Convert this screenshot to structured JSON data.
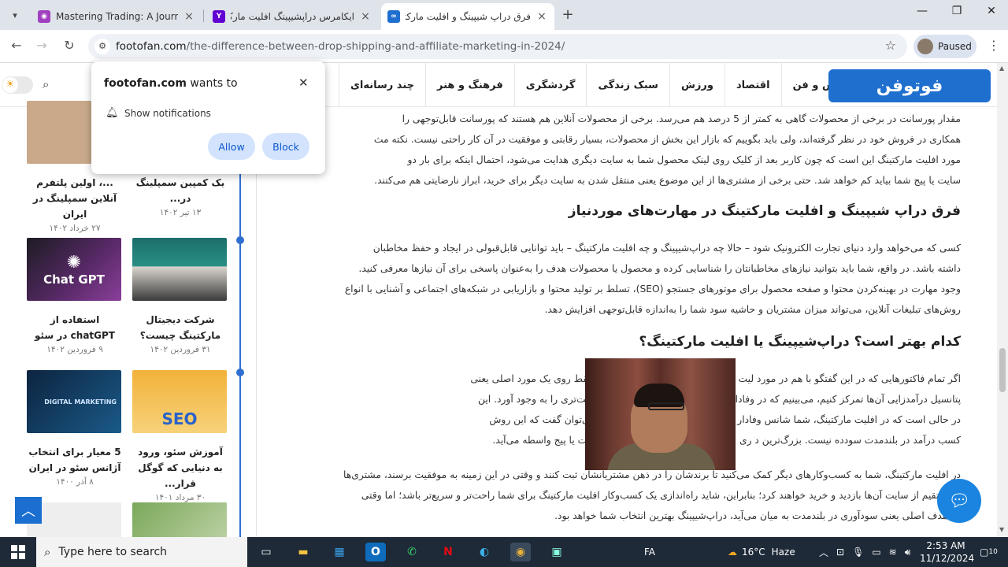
{
  "browser": {
    "tabs": [
      {
        "title": "Mastering Trading: A Journey fr",
        "favicon": "podcast-icon",
        "color": "#a03fbf"
      },
      {
        "title": "ایکامرس دراپشیپینگ افلیت مارکتی",
        "favicon": "yahoo-icon",
        "color": "#6001d2"
      },
      {
        "title": "فرق دراپ شیپینگ و افلیت مارکتی",
        "favicon": "footofan-icon",
        "color": "#1f6fcf"
      }
    ],
    "active_tab": 2,
    "url_host": "footofan.com",
    "url_path": "/the-difference-between-drop-shipping-and-affiliate-marketing-in-2024/",
    "profile_label": "Paused"
  },
  "popup": {
    "site": "footofan.com",
    "title_suffix": "wants to",
    "permission": "Show notifications",
    "allow_label": "Allow",
    "block_label": "Block"
  },
  "site": {
    "logo_text": "فوتوفن",
    "menu": [
      "دانش و فن",
      "اقتصاد",
      "ورزش",
      "سبک زندگی",
      "گردشگری",
      "فرهنگ و هنر",
      "چند رسانه‌ای"
    ]
  },
  "sidebar": {
    "cards": [
      {
        "title": "...، اولین پلتفرم آنلاین سمپلینگ در ایران",
        "date": "۲۷ خرداد ۱۴۰۲"
      },
      {
        "title": "یک کمپین سمپلینگ در...",
        "date": "۱۳ تیر ۱۴۰۲"
      },
      {
        "title": "استفاده از chatGPT در سئو",
        "date": "۹ فروردین ۱۴۰۲",
        "thumb_text": "Chat GPT"
      },
      {
        "title": "شرکت دیجیتال مارکتینگ چیست؟",
        "date": "۳۱ فروردین ۱۴۰۲"
      },
      {
        "title": "5 معیار برای انتخاب آژانس سئو در ایران",
        "date": "۸ آذر ۱۴۰۰",
        "thumb_text": "DIGITAL MARKETING"
      },
      {
        "title": "آموزش سئو، ورود به دنیایی که گوگل قرار...",
        "date": "۳۰ مرداد ۱۴۰۱",
        "thumb_text": "SEO"
      }
    ]
  },
  "article": {
    "para1": [
      "مقدار پورسانت در برخی از محصولات گاهی به کمتر از 5 درصد هم می‌رسد. برخی از محصولات آنلاین هم هستند که پورسانت قابل‌توجهی را",
      "همکاری در فروش خود در نظر گرفته‌اند، ولی باید بگوییم که بازار این بخش از محصولات، بسیار رقابتی و موفقیت در آن کار راحتی نیست. نکته مث",
      "مورد افلیت مارکتینگ این است که چون کاربر بعد از کلیک روی لینک محصول شما به سایت دیگری هدایت می‌شود، احتمال اینکه برای بار دو",
      "سایت یا پیج شما بیاید کم خواهد شد. حتی برخی از مشتری‌ها از این موضوع یعنی منتقل شدن به سایت دیگر برای خرید، ابراز نارضایتی هم می‌کنند."
    ],
    "heading1": "فرق دراپ شیپینگ و افلیت مارکتینگ در مهارت‌های موردنیاز",
    "para2": [
      "کسی که می‌خواهد وارد دنیای تجارت الکترونیک شود – حالا چه دراپ‌شیپینگ و چه افلیت مارکتینگ – باید توانایی قابل‌قبولی در ایجاد و حفظ مخاطبان",
      "داشته باشد. در واقع، شما باید بتوانید نیازهای مخاطبانتان را شناسایی کرده و محصول یا محصولات هدف را به‌عنوان پاسخی برای آن نیازها معرفی کنید.",
      "وجود مهارت در بهینه‌کردن محتوا و صفحه محصول برای موتورهای جستجو (SEO)، تسلط بر تولید محتوا و بازاریابی در شبکه‌های اجتماعی و آشنایی با انواع",
      "روش‌های تبلیغات آنلاین، می‌تواند میزان مشتریان و حاشیه سود شما را به‌اندازه قابل‌توجهی افزایش دهد."
    ],
    "heading2": "کدام بهتر است؟ دراپ‌شیپینگ یا افلیت مارکتینگ؟",
    "para3": [
      "اگر تمام فاکتورهایی که در این گفتگو با هم در مورد                                             لیت مارکتینگ شمردیم را کنار بگذاریم و فقط روی یک مورد اصلی یعنی",
      "پتانسیل درآمدزایی آن‌ها تمرکز کنیم، می‌بینیم که در                                            وفادار برای فروشگاهتان می‌تواند درآمد ثابت‌تری را به وجود آورد. این",
      "در حالی است که در افلیت مارکتینگ، شما شانس                                                  وفادار و درآمد ثابت خواهید داشت و حتی می‌توان گفت که این روش",
      "کسب درآمد در بلندمدت سودده نیست. بزرگ‌ترین د                                                ری برای یک محصول، دو بار به سراغ سایت یا پیج واسطه می‌آید."
    ],
    "para4": [
      "در افلیت مارکتینگ، شما به کسب‌وکارهای دیگر کمک می‌کنید تا برندشان را در ذهن مشتریانشان ثبت کنند و وقتی در این زمینه به موفقیت برسند، مشتری‌ها",
      "ر مستقیم از سایت آن‌ها بازدید و خرید خواهند کرد؛ بنابراین، شاید راه‌اندازی یک کسب‌وکار افلیت مارکتینگ برای شما راحت‌تر و سریع‌تر باشد؛ اما وقتی",
      "ف هدف اصلی یعنی سودآوری در بلندمدت به میان می‌آید، دراپ‌شیپینگ بهترین انتخاب شما خواهد بود."
    ]
  },
  "taskbar": {
    "search_placeholder": "Type here to search",
    "lang": "FA",
    "weather_temp": "16°C",
    "weather_desc": "Haze",
    "time": "2:53 AM",
    "date": "11/12/2024",
    "notif_count": "1",
    "tray_badge": "10"
  }
}
